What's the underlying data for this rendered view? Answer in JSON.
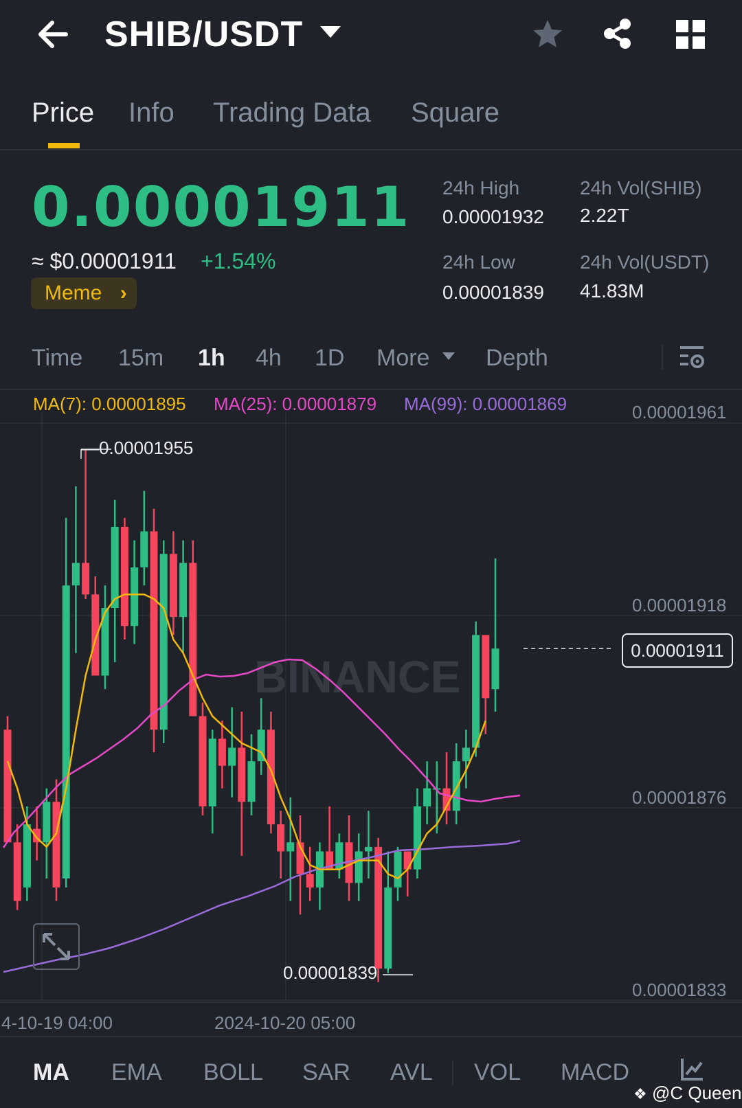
{
  "header": {
    "pair": "SHIB/USDT"
  },
  "tabs": [
    {
      "label": "Price"
    },
    {
      "label": "Info"
    },
    {
      "label": "Trading Data"
    },
    {
      "label": "Square"
    }
  ],
  "ticker": {
    "price": "0.00001911",
    "approx": "≈ $0.00001911",
    "change": "+1.54%",
    "tag": "Meme",
    "high_label": "24h High",
    "high": "0.00001932",
    "low_label": "24h Low",
    "low": "0.00001839",
    "vol_base_label": "24h Vol(SHIB)",
    "vol_base": "2.22T",
    "vol_quote_label": "24h Vol(USDT)",
    "vol_quote": "41.83M"
  },
  "intervals": [
    {
      "label": "Time"
    },
    {
      "label": "15m"
    },
    {
      "label": "1h"
    },
    {
      "label": "4h"
    },
    {
      "label": "1D"
    },
    {
      "label": "More"
    },
    {
      "label": "Depth"
    }
  ],
  "ma_legend": {
    "ma7": "MA(7): 0.00001895",
    "ma25": "MA(25): 0.00001879",
    "ma99": "MA(99): 0.00001869"
  },
  "chart": {
    "price_axis": [
      "0.00001961",
      "0.00001918",
      "0.00001876",
      "0.00001833"
    ],
    "current": "0.00001911",
    "high_marker": "0.00001955",
    "low_marker": "0.00001839",
    "watermark": "BINANCE",
    "time_labels": [
      "4-10-19 04:00",
      "2024-10-20 05:00"
    ]
  },
  "indicators": [
    {
      "label": "MA"
    },
    {
      "label": "EMA"
    },
    {
      "label": "BOLL"
    },
    {
      "label": "SAR"
    },
    {
      "label": "AVL"
    },
    {
      "label": "VOL"
    },
    {
      "label": "MACD"
    }
  ],
  "watermark_user": "@C Queen",
  "colors": {
    "up": "#2ebd85",
    "down": "#f6465d",
    "ma7": "#f0b90b",
    "ma25": "#e649c6",
    "ma99": "#9a6cdb",
    "accent": "#f0b90b"
  },
  "chart_data": {
    "type": "candlestick",
    "ylim": [
      1.833e-05,
      1.961e-05
    ],
    "candles_ohlc": [
      [
        1.893e-05,
        1.896e-05,
        1.868e-05,
        1.868e-05
      ],
      [
        1.868e-05,
        1.872e-05,
        1.853e-05,
        1.855e-05
      ],
      [
        1.858e-05,
        1.876e-05,
        1.855e-05,
        1.872e-05
      ],
      [
        1.871e-05,
        1.876e-05,
        1.864e-05,
        1.868e-05
      ],
      [
        1.868e-05,
        1.88e-05,
        1.86e-05,
        1.877e-05
      ],
      [
        1.877e-05,
        1.882e-05,
        1.855e-05,
        1.858e-05
      ],
      [
        1.86e-05,
        1.94e-05,
        1.858e-05,
        1.925e-05
      ],
      [
        1.925e-05,
        1.947e-05,
        1.91e-05,
        1.93e-05
      ],
      [
        1.93e-05,
        1.955e-05,
        1.922e-05,
        1.923e-05
      ],
      [
        1.923e-05,
        1.927e-05,
        1.905e-05,
        1.905e-05
      ],
      [
        1.905e-05,
        1.925e-05,
        1.902e-05,
        1.92e-05
      ],
      [
        1.92e-05,
        1.944e-05,
        1.908e-05,
        1.938e-05
      ],
      [
        1.938e-05,
        1.94e-05,
        1.913e-05,
        1.916e-05
      ],
      [
        1.916e-05,
        1.935e-05,
        1.912e-05,
        1.929e-05
      ],
      [
        1.929e-05,
        1.946e-05,
        1.925e-05,
        1.937e-05
      ],
      [
        1.937e-05,
        1.942e-05,
        1.888e-05,
        1.893e-05
      ],
      [
        1.893e-05,
        1.935e-05,
        1.89e-05,
        1.932e-05
      ],
      [
        1.932e-05,
        1.937e-05,
        1.914e-05,
        1.918e-05
      ],
      [
        1.918e-05,
        1.935e-05,
        1.91e-05,
        1.93e-05
      ],
      [
        1.93e-05,
        1.935e-05,
        1.896e-05,
        1.896e-05
      ],
      [
        1.896e-05,
        1.899e-05,
        1.874e-05,
        1.876e-05
      ],
      [
        1.876e-05,
        1.893e-05,
        1.87e-05,
        1.891e-05
      ],
      [
        1.891e-05,
        1.895e-05,
        1.88e-05,
        1.885e-05
      ],
      [
        1.885e-05,
        1.898e-05,
        1.878e-05,
        1.889e-05
      ],
      [
        1.889e-05,
        1.897e-05,
        1.865e-05,
        1.877e-05
      ],
      [
        1.877e-05,
        1.892e-05,
        1.874e-05,
        1.886e-05
      ],
      [
        1.886e-05,
        1.9e-05,
        1.883e-05,
        1.893e-05
      ],
      [
        1.893e-05,
        1.897e-05,
        1.87e-05,
        1.872e-05
      ],
      [
        1.872e-05,
        1.875e-05,
        1.86e-05,
        1.866e-05
      ],
      [
        1.866e-05,
        1.878e-05,
        1.855e-05,
        1.868e-05
      ],
      [
        1.868e-05,
        1.874e-05,
        1.852e-05,
        1.861e-05
      ],
      [
        1.861e-05,
        1.867e-05,
        1.855e-05,
        1.858e-05
      ],
      [
        1.858e-05,
        1.868e-05,
        1.853e-05,
        1.866e-05
      ],
      [
        1.866e-05,
        1.876e-05,
        1.862e-05,
        1.862e-05
      ],
      [
        1.862e-05,
        1.87e-05,
        1.86e-05,
        1.868e-05
      ],
      [
        1.868e-05,
        1.874e-05,
        1.855e-05,
        1.859e-05
      ],
      [
        1.859e-05,
        1.87e-05,
        1.855e-05,
        1.866e-05
      ],
      [
        1.866e-05,
        1.875e-05,
        1.86e-05,
        1.867e-05
      ],
      [
        1.867e-05,
        1.869e-05,
        1.837e-05,
        1.84e-05
      ],
      [
        1.84e-05,
        1.866e-05,
        1.839e-05,
        1.858e-05
      ],
      [
        1.858e-05,
        1.867e-05,
        1.855e-05,
        1.866e-05
      ],
      [
        1.866e-05,
        1.866e-05,
        1.856e-05,
        1.862e-05
      ],
      [
        1.862e-05,
        1.88e-05,
        1.86e-05,
        1.876e-05
      ],
      [
        1.876e-05,
        1.886e-05,
        1.872e-05,
        1.88e-05
      ],
      [
        1.88e-05,
        1.886e-05,
        1.87e-05,
        1.88e-05
      ],
      [
        1.88e-05,
        1.888e-05,
        1.872e-05,
        1.875e-05
      ],
      [
        1.875e-05,
        1.89e-05,
        1.872e-05,
        1.886e-05
      ],
      [
        1.886e-05,
        1.893e-05,
        1.88e-05,
        1.889e-05
      ],
      [
        1.889e-05,
        1.917e-05,
        1.887e-05,
        1.914e-05
      ],
      [
        1.914e-05,
        1.914e-05,
        1.892e-05,
        1.9e-05
      ],
      [
        1.902e-05,
        1.931e-05,
        1.897e-05,
        1.911e-05
      ]
    ],
    "ma7_price": [
      1.886e-05,
      1.88e-05,
      1.872e-05,
      1.869e-05,
      1.867e-05,
      1.87e-05,
      1.88e-05,
      1.893e-05,
      1.905e-05,
      1.913e-05,
      1.919e-05,
      1.922e-05,
      1.923e-05,
      1.923e-05,
      1.923e-05,
      1.922e-05,
      1.92e-05,
      1.913e-05,
      1.91e-05,
      1.905e-05,
      1.9e-05,
      1.896e-05,
      1.894e-05,
      1.892e-05,
      1.89e-05,
      1.889e-05,
      1.888e-05,
      1.884e-05,
      1.878e-05,
      1.873e-05,
      1.867e-05,
      1.863e-05,
      1.862e-05,
      1.862e-05,
      1.862e-05,
      1.863e-05,
      1.864e-05,
      1.864e-05,
      1.864e-05,
      1.861e-05,
      1.86e-05,
      1.862e-05,
      1.866e-05,
      1.87e-05,
      1.872e-05,
      1.876e-05,
      1.88e-05,
      1.884e-05,
      1.889e-05,
      1.895e-05
    ]
  }
}
